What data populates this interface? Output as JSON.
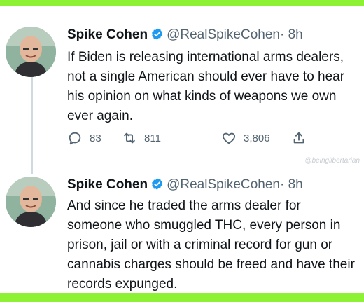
{
  "tweets": [
    {
      "name": "Spike Cohen",
      "handle": "@RealSpikeCohen",
      "time": "· 8h",
      "text": "If Biden is releasing international arms dealers, not a single American should ever have to hear his opinion on what kinds of weapons we own ever again.",
      "replies": "83",
      "retweets": "811",
      "likes": "3,806"
    },
    {
      "name": "Spike Cohen",
      "handle": "@RealSpikeCohen",
      "time": "· 8h",
      "text": "And since he traded the arms dealer for someone who smuggled THC, every person in prison, jail or with a criminal record for gun or cannabis charges should be freed and have their records expunged."
    }
  ],
  "watermark": "@beinglibertarian",
  "colors": {
    "border": "#8ef234",
    "verified": "#1d9bf0",
    "text": "#0f1419",
    "muted": "#536471"
  }
}
